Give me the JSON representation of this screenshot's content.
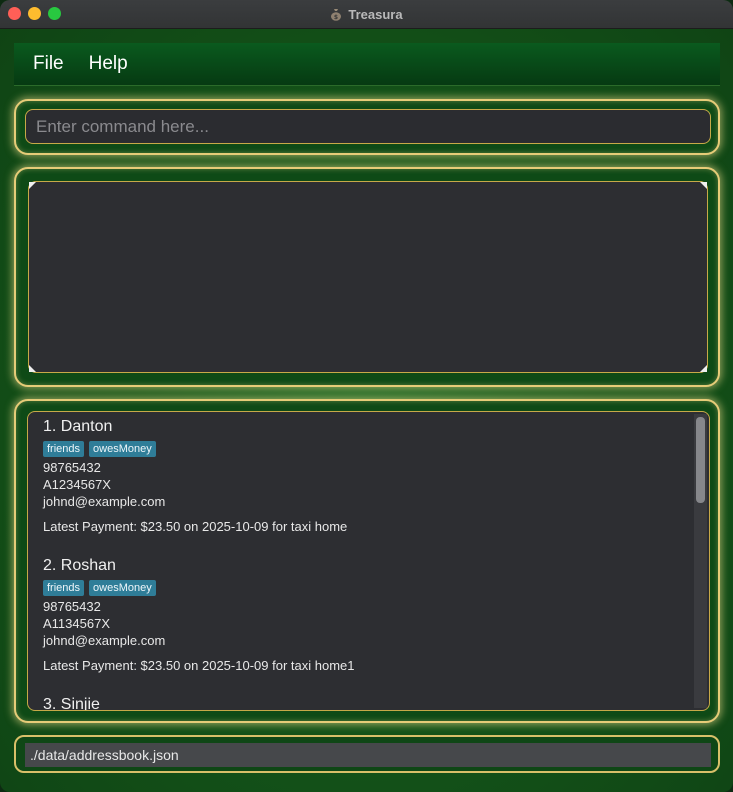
{
  "window": {
    "title": "Treasura"
  },
  "menu": {
    "items": [
      "File",
      "Help"
    ]
  },
  "command": {
    "placeholder": "Enter command here...",
    "value": ""
  },
  "result": {
    "text": ""
  },
  "persons": [
    {
      "index_name": "1. Danton",
      "tags": [
        "friends",
        "owesMoney"
      ],
      "phone": "98765432",
      "id": "A1234567X",
      "email": "johnd@example.com",
      "payment": "Latest Payment: $23.50 on 2025-10-09 for taxi home"
    },
    {
      "index_name": "2. Roshan",
      "tags": [
        "friends",
        "owesMoney"
      ],
      "phone": "98765432",
      "id": "A1134567X",
      "email": "johnd@example.com",
      "payment": "Latest Payment: $23.50 on 2025-10-09 for taxi home1"
    },
    {
      "index_name": "3. Sinjie"
    }
  ],
  "status": {
    "path": "./data/addressbook.json"
  },
  "colors": {
    "accent_gold": "#e6cc78",
    "tag_bg": "#2f7d98",
    "panel_bg": "#2d2e32"
  }
}
